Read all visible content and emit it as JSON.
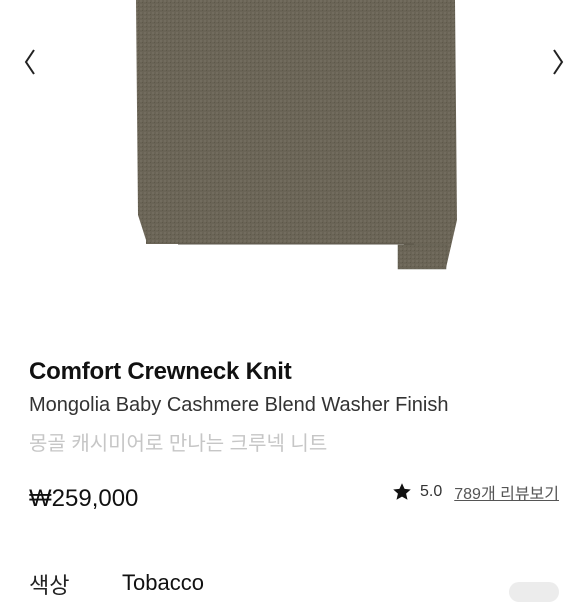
{
  "gallery": {
    "prev_icon": "chevron-left-icon",
    "next_icon": "chevron-right-icon",
    "product_color": "#6a6456"
  },
  "product": {
    "title": "Comfort Crewneck Knit",
    "subtitle": "Mongolia Baby Cashmere Blend Washer Finish",
    "korean_name": "몽골 캐시미어로 만나는 크루넥 니트",
    "price": "₩259,000"
  },
  "rating": {
    "icon": "star-icon",
    "score": "5.0",
    "review_link": "789개 리뷰보기"
  },
  "options": {
    "color_label": "색상",
    "color_value": "Tobacco"
  }
}
